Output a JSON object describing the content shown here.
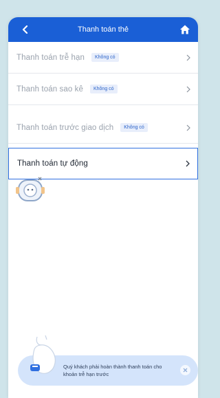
{
  "header": {
    "title": "Thanh toán thẻ",
    "back_icon": "chevron-left-icon",
    "home_icon": "home-icon",
    "color": "#1a5fd6"
  },
  "rows": [
    {
      "label": "Thanh toán trễ hạn",
      "badge": "Không có"
    },
    {
      "label": "Thanh toán sao kê",
      "badge": "Không có"
    },
    {
      "label": "Thanh toán trước giao dịch",
      "badge": "Không có"
    },
    {
      "label": "Thanh toán tự động",
      "badge": ""
    }
  ],
  "toast": {
    "message": "Quý khách phải hoàn thành thanh toán cho khoản trễ hạn trước",
    "close_icon": "close-icon"
  },
  "colors": {
    "accent": "#1a5fd6",
    "selected_border": "#2f6fe0",
    "badge_bg": "#e8eefb",
    "toast_bg": "#d4e4fb"
  }
}
